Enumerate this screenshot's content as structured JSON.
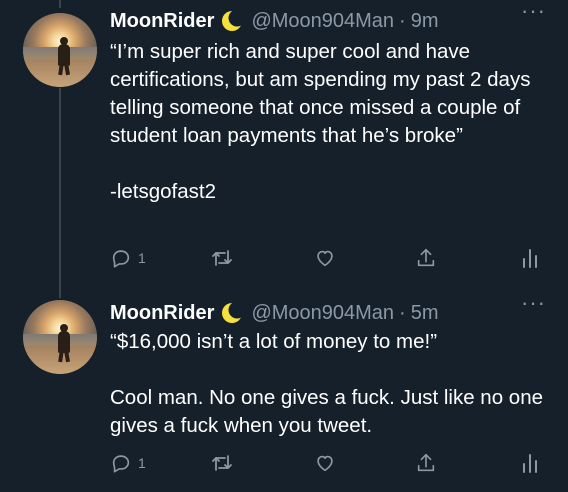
{
  "tweets": [
    {
      "author": {
        "name": "MoonRider",
        "handle": "@Moon904Man",
        "separator": "·",
        "time": "9m",
        "badge_icon": "crescent-moon-icon"
      },
      "text_paragraphs": [
        "“I’m super rich and super cool and have certifications, but am spending my past 2 days  telling someone that once missed a couple of student loan payments that he’s broke”",
        "-letsgofast2"
      ],
      "actions": {
        "reply_count": "1",
        "retweet_count": "",
        "like_count": ""
      }
    },
    {
      "author": {
        "name": "MoonRider",
        "handle": "@Moon904Man",
        "separator": "·",
        "time": "5m",
        "badge_icon": "crescent-moon-icon"
      },
      "text_paragraphs": [
        "“$16,000 isn’t a lot of money to me!”",
        "Cool man. No one gives a fuck. Just like no one gives a fuck when you tweet."
      ],
      "actions": {
        "reply_count": "1",
        "retweet_count": "",
        "like_count": ""
      }
    }
  ],
  "more_label": "···",
  "colors": {
    "background": "#15202b",
    "secondary_text": "#8b98a5",
    "primary_text": "#ffffff",
    "thread_line": "#38444d",
    "moon_badge": "#f6e03b"
  }
}
